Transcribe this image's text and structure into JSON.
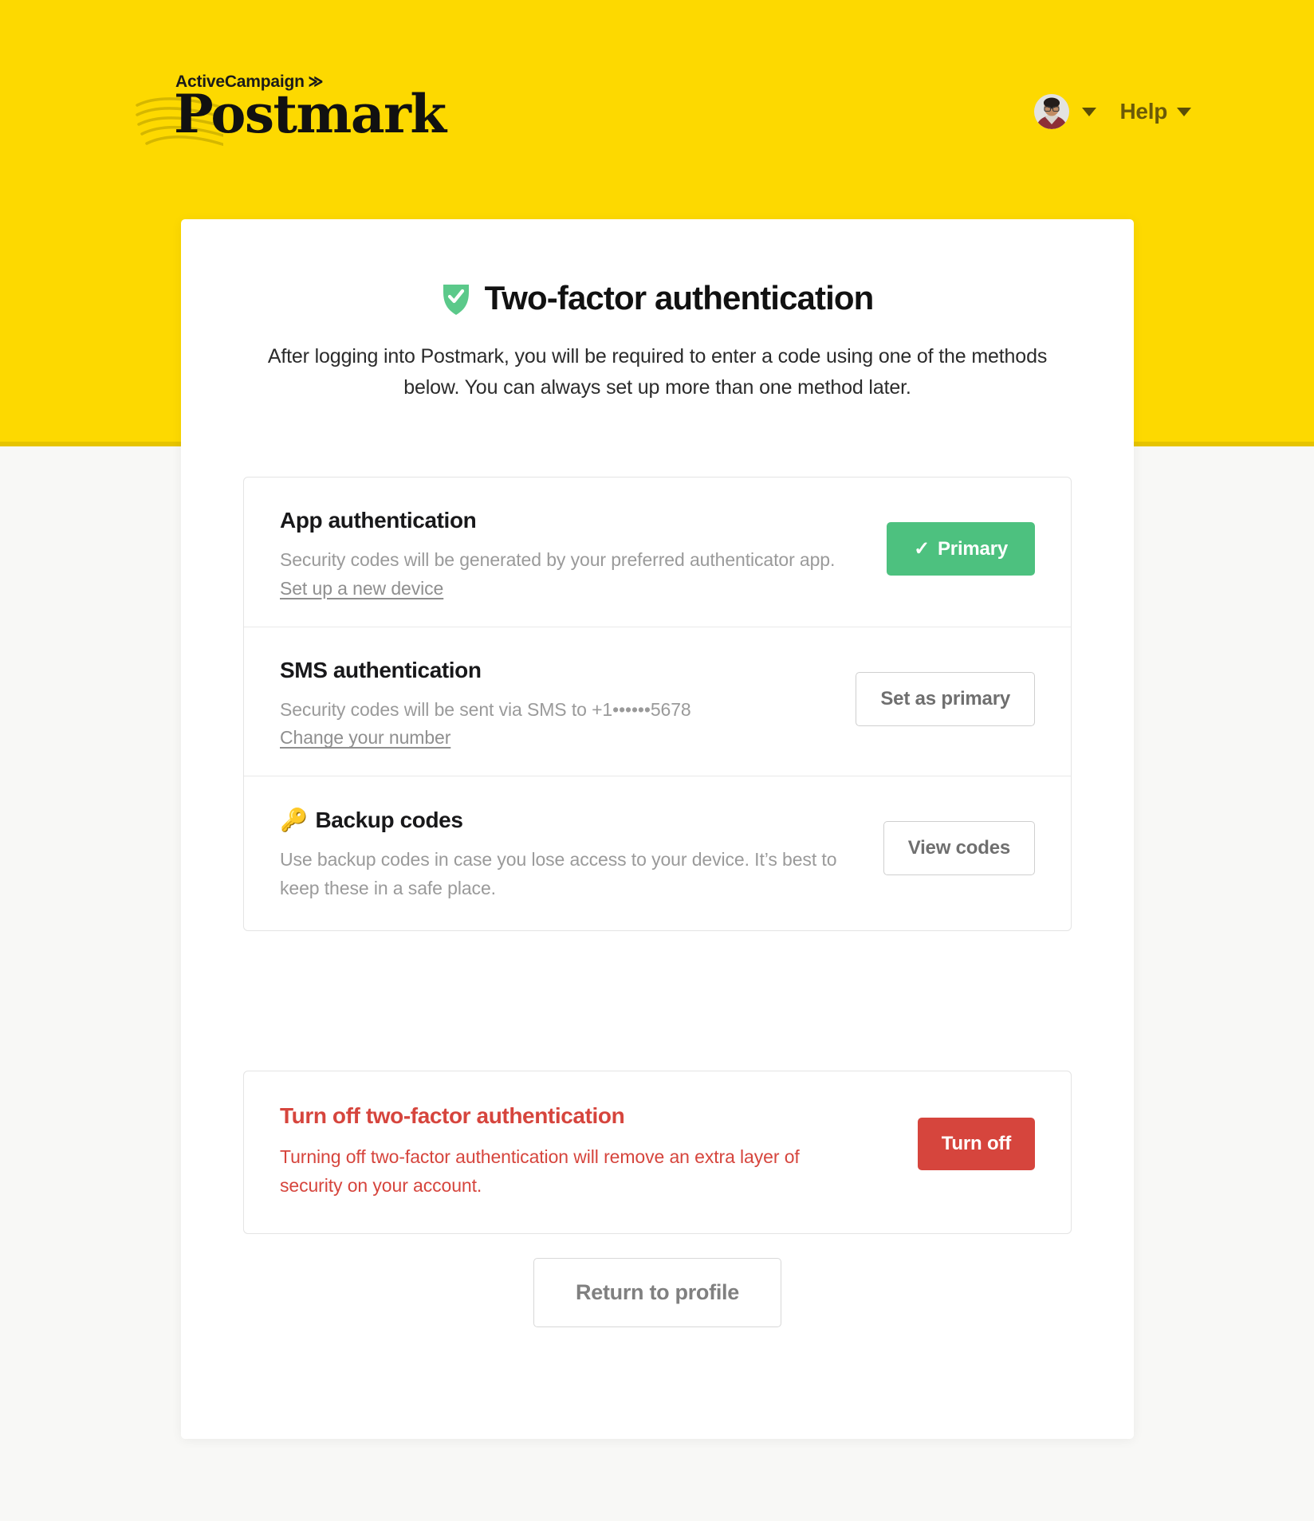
{
  "header": {
    "brand_eyebrow": "ActiveCampaign",
    "brand_chevron": "≫",
    "brand_wordmark": "Postmark",
    "help_label": "Help"
  },
  "page": {
    "title": "Two-factor authentication",
    "title_icon": "shield-check-icon",
    "subtitle": "After logging into Postmark, you will be required to enter a code using one of the methods below. You can always set up more than one method later."
  },
  "methods": [
    {
      "id": "app-authentication",
      "title": "App authentication",
      "title_emoji": "",
      "description": "Security codes will be generated by your preferred authenticator app.",
      "link_label": "Set up a new device",
      "action_label": "Primary",
      "action_check": "✓",
      "action_style": "primary-green"
    },
    {
      "id": "sms-authentication",
      "title": "SMS authentication",
      "title_emoji": "",
      "description": "Security codes will be sent via SMS to +1••••••5678",
      "link_label": "Change your number",
      "stray_mark": ".",
      "action_label": "Set as primary",
      "action_style": "outline"
    },
    {
      "id": "backup-codes",
      "title": "Backup codes",
      "title_emoji": "🔑",
      "description": "Use backup codes in case you lose access to your device. It’s best to keep these in a safe place.",
      "link_label": "",
      "action_label": "View codes",
      "action_style": "outline"
    }
  ],
  "danger": {
    "title": "Turn off two-factor authentication",
    "description": "Turning off two-factor authentication will remove an extra layer of security on your account.",
    "action_label": "Turn off"
  },
  "footer": {
    "return_label": "Return to profile"
  },
  "colors": {
    "brand_yellow": "#fdd900",
    "brand_yellow_border": "#e6c400",
    "page_background": "#f8f8f6",
    "primary_green": "#4dc17f",
    "danger_red": "#d6453d",
    "muted_text": "#9a9a9a",
    "title_text": "#111111"
  }
}
